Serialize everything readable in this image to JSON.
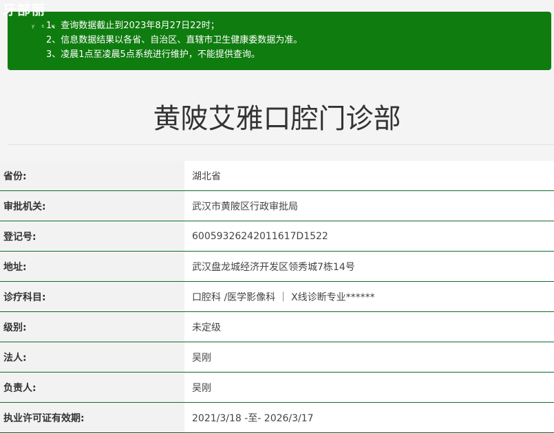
{
  "watermark": {
    "logo_text": "牙部丽",
    "sub_text": "y s w"
  },
  "notice": {
    "lines": [
      "1、查询数据截止到2023年8月27日22时；",
      "2、信息数据结果以各省、自治区、直辖市卫生健康委数据为准。",
      "3、凌晨1点至凌晨5点系统进行维护，不能提供查询。"
    ]
  },
  "page_title": "黄陂艾雅口腔门诊部",
  "colors": {
    "notice_bg": "#0f7c0f",
    "row_border": "#0f6a2a"
  },
  "info_rows": [
    {
      "label": "省份:",
      "value": "湖北省"
    },
    {
      "label": "审批机关:",
      "value": "武汉市黄陂区行政审批局"
    },
    {
      "label": "登记号:",
      "value": "60059326242011617D1522"
    },
    {
      "label": "地址:",
      "value": "武汉盘龙城经济开发区领秀城7栋14号"
    },
    {
      "label": "诊疗科目:",
      "value": "口腔科 /医学影像科 ｜ X线诊断专业******"
    },
    {
      "label": "级别:",
      "value": "未定级"
    },
    {
      "label": "法人:",
      "value": "吴刚"
    },
    {
      "label": "负责人:",
      "value": "吴刚"
    },
    {
      "label": "执业许可证有效期:",
      "value": "2021/3/18 -至- 2026/3/17"
    }
  ]
}
